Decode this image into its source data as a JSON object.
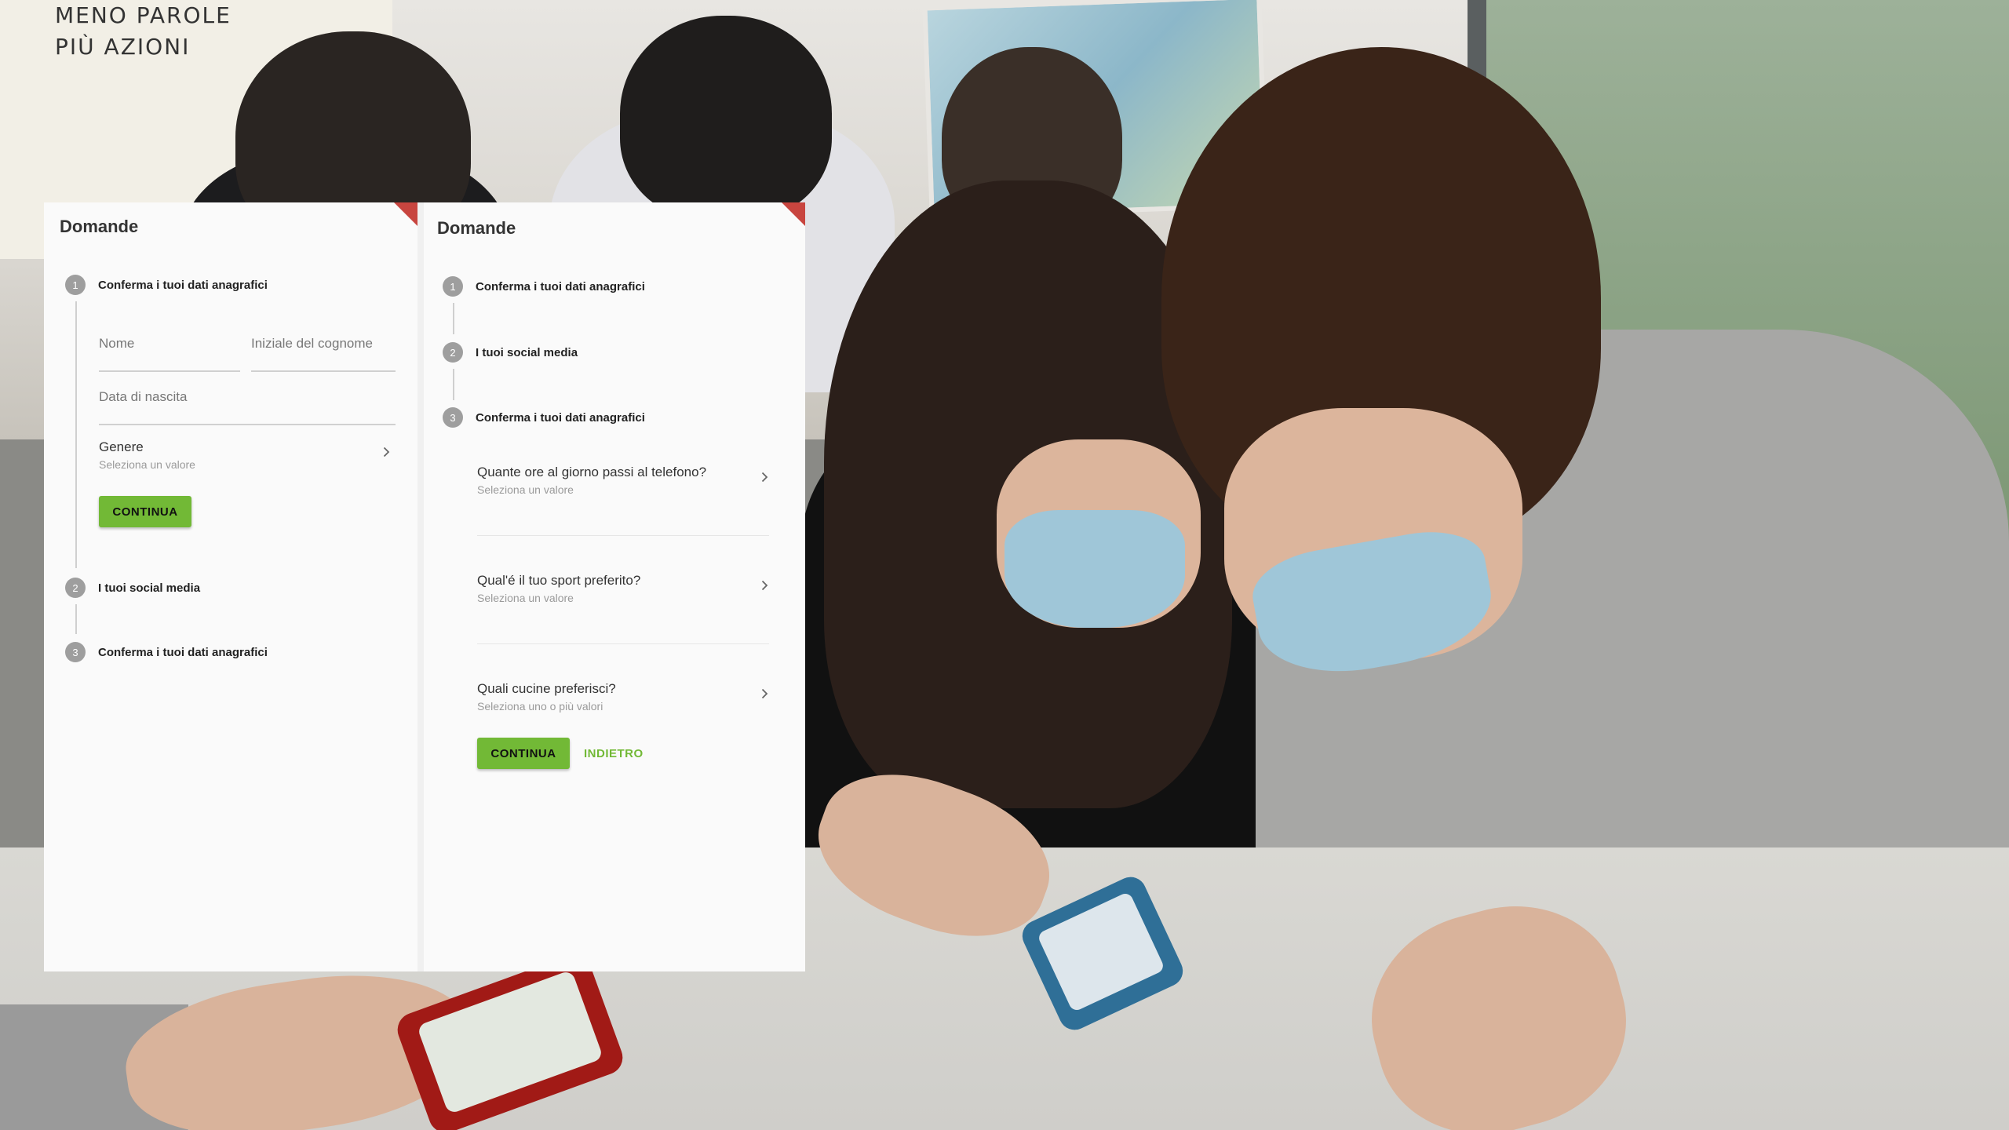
{
  "background": {
    "poster_text_line1": "MENO  PAROLE",
    "poster_text_line2": "PIÙ  AZIONI"
  },
  "left_panel": {
    "title": "Domande",
    "steps": [
      {
        "number": "1",
        "label": "Conferma i tuoi dati anagrafici"
      },
      {
        "number": "2",
        "label": "I tuoi social media"
      },
      {
        "number": "3",
        "label": "Conferma i tuoi dati anagrafici"
      }
    ],
    "fields": {
      "nome_placeholder": "Nome",
      "cognome_placeholder": "Iniziale del cognome",
      "nascita_placeholder": "Data di nascita"
    },
    "genere": {
      "title": "Genere",
      "subtitle": "Seleziona un valore"
    },
    "continue_label": "CONTINUA"
  },
  "right_panel": {
    "title": "Domande",
    "steps": [
      {
        "number": "1",
        "label": "Conferma i tuoi dati anagrafici"
      },
      {
        "number": "2",
        "label": "I tuoi social media"
      },
      {
        "number": "3",
        "label": "Conferma i tuoi dati anagrafici"
      }
    ],
    "questions": [
      {
        "title": "Quante ore al giorno passi al telefono?",
        "subtitle": "Seleziona un valore"
      },
      {
        "title": "Qual'é il tuo sport preferito?",
        "subtitle": "Seleziona un valore"
      },
      {
        "title": "Quali cucine preferisci?",
        "subtitle": "Seleziona uno o più valori"
      }
    ],
    "continue_label": "CONTINUA",
    "back_label": "INDIETRO"
  },
  "colors": {
    "accent_green": "#72b936",
    "step_circle": "#9e9e9e",
    "ribbon_red": "#c8453f"
  },
  "icons": {
    "chevron": "chevron-right-icon"
  }
}
